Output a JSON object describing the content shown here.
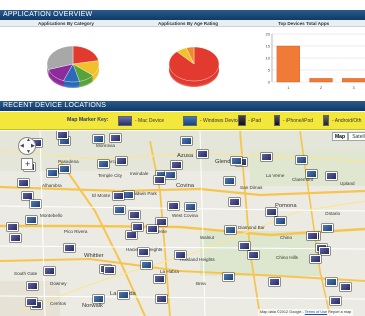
{
  "sections": {
    "overview_title": "APPLICATION OVERVIEW",
    "locations_title": "RECENT DEVICE LOCATIONS"
  },
  "subheads": {
    "by_category": "Applications By Category",
    "by_age": "Applications By Age Rating",
    "top_devices": "Top Devices Total Apps"
  },
  "chart_data": [
    {
      "type": "pie",
      "title": "Applications By Category",
      "slices": [
        {
          "value": 22,
          "color": "#e23a2f"
        },
        {
          "value": 14,
          "color": "#f2c02a"
        },
        {
          "value": 10,
          "color": "#57a23b"
        },
        {
          "value": 10,
          "color": "#2a6ab8"
        },
        {
          "value": 14,
          "color": "#8c2b9a"
        },
        {
          "value": 30,
          "color": "#a8a8a8"
        }
      ]
    },
    {
      "type": "pie",
      "title": "Applications By Age Rating",
      "slices": [
        {
          "value": 88,
          "color": "#e23a2f"
        },
        {
          "value": 7,
          "color": "#f2c02a"
        },
        {
          "value": 5,
          "color": "#f08a2a"
        }
      ]
    },
    {
      "type": "bar",
      "title": "Top Devices Total Apps",
      "categories": [
        "1",
        "2",
        "3"
      ],
      "values": [
        15,
        1.5,
        1.5
      ],
      "ylim": [
        0,
        20
      ],
      "yticks": [
        "0",
        "5",
        "10",
        "15",
        "20"
      ],
      "color": "#f07a36"
    }
  ],
  "legend": {
    "title": "Map Marker Key:",
    "items": [
      {
        "label": "- Mac Device",
        "icon": "mac-device-icon"
      },
      {
        "label": "- Windows Device",
        "icon": "windows-device-icon"
      },
      {
        "label": "- iPad",
        "icon": "ipad-icon"
      },
      {
        "label": "- iPhone/iPod",
        "icon": "iphone-icon"
      },
      {
        "label": "- Android/Oth",
        "icon": "android-icon"
      }
    ]
  },
  "map": {
    "map_button": "Map",
    "satellite_button": "Satelli",
    "zoom_label": "+",
    "attribution": "Map data ©2012 Google -",
    "terms_link": "Terms of Use",
    "report_link": "Report a map",
    "places": [
      "Monrovia",
      "Pasadena",
      "Glendora",
      "Azusa",
      "La Verne",
      "San Dimas",
      "Covina",
      "Pomona",
      "Chino",
      "Chino Hills",
      "Ontario",
      "West Covina",
      "Walnut",
      "Diamond Bar",
      "El Monte",
      "Temple City",
      "Arcadia",
      "Whittier",
      "La Habra",
      "Hacienda Heights",
      "Rowland Heights",
      "La Mirada",
      "South Gate",
      "Downey",
      "Norwalk",
      "Montebello",
      "Pico Rivera",
      "Alhambra",
      "Irwindale",
      "Baldwin Park",
      "Upland",
      "La Puente",
      "Claremont",
      "Brea",
      "Cerritos"
    ]
  }
}
